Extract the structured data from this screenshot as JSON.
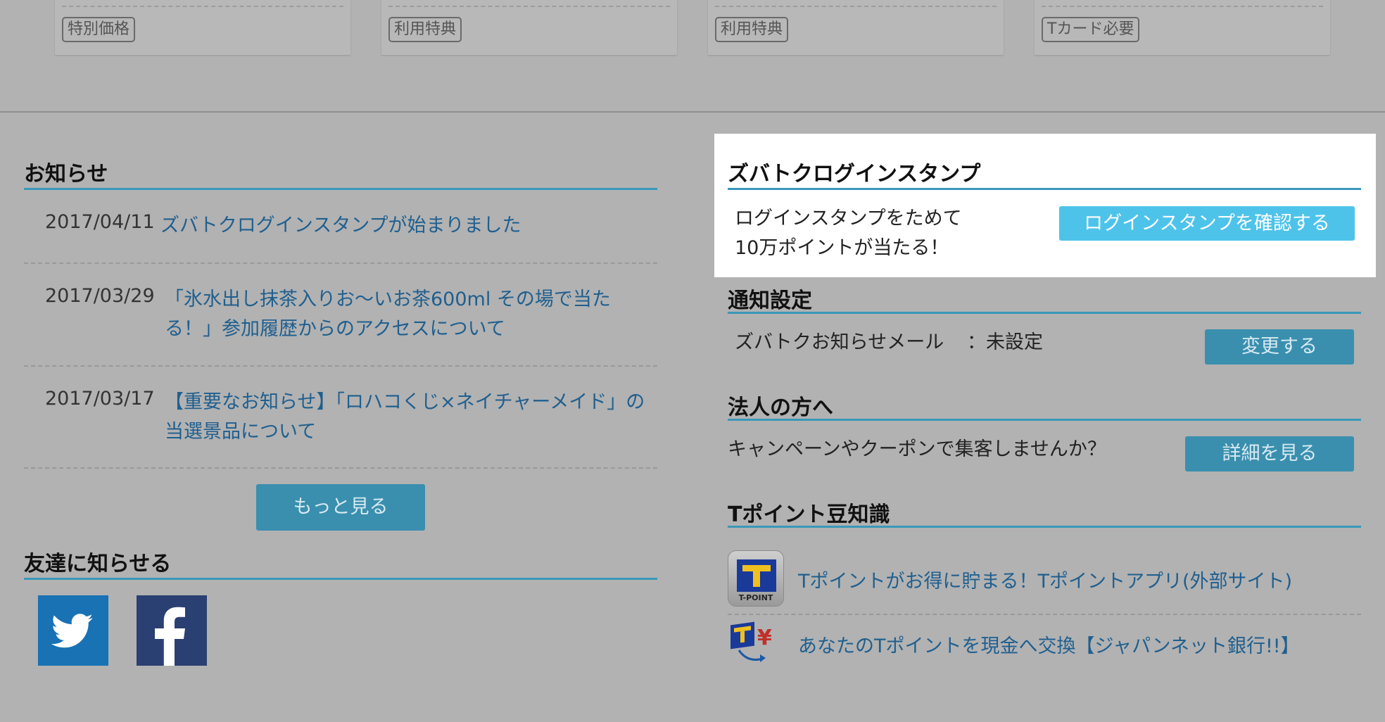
{
  "cards": [
    {
      "tag": "特別価格"
    },
    {
      "tag": "利用特典"
    },
    {
      "tag": "利用特典"
    },
    {
      "tag": "Tカード必要"
    }
  ],
  "news": {
    "title": "お知らせ",
    "items": [
      {
        "date": "2017/04/11",
        "text": "ズバトクログインスタンプが始まりました"
      },
      {
        "date": "2017/03/29",
        "text": "「氷水出し抹茶入りお～いお茶600ml その場で当たる！」参加履歴からのアクセスについて"
      },
      {
        "date": "2017/03/17",
        "text": "【重要なお知らせ】「ロハコくじ×ネイチャーメイド」の当選景品について"
      }
    ],
    "more_label": "もっと見る"
  },
  "share": {
    "title": "友達に知らせる",
    "twitter_color": "#1872b4",
    "facebook_color": "#2a3f72"
  },
  "stamp": {
    "title": "ズバトクログインスタンプ",
    "line1": "ログインスタンプをためて",
    "line2": "10万ポイントが当たる！",
    "button_label": "ログインスタンプを確認する"
  },
  "notify": {
    "title": "通知設定",
    "mail_label": "ズバトクお知らせメール",
    "mail_status": "：未設定",
    "button_label": "変更する"
  },
  "corp": {
    "title": "法人の方へ",
    "text": "キャンペーンやクーポンで集客しませんか？",
    "button_label": "詳細を見る"
  },
  "tips": {
    "title": "Tポイント豆知識",
    "app_icon_caption": "T-POINT",
    "items": [
      {
        "text": "Tポイントがお得に貯まる！Tポイントアプリ(外部サイト)",
        "icon": "tpoint-app-icon"
      },
      {
        "text": "あなたのTポイントを現金へ交換【ジャパンネット銀行!!】",
        "icon": "tpoint-exchange-icon"
      }
    ]
  },
  "colors": {
    "accent_rule": "#3a98b8",
    "link": "#1f5f8f",
    "stamp_button": "#4ec3ea"
  }
}
